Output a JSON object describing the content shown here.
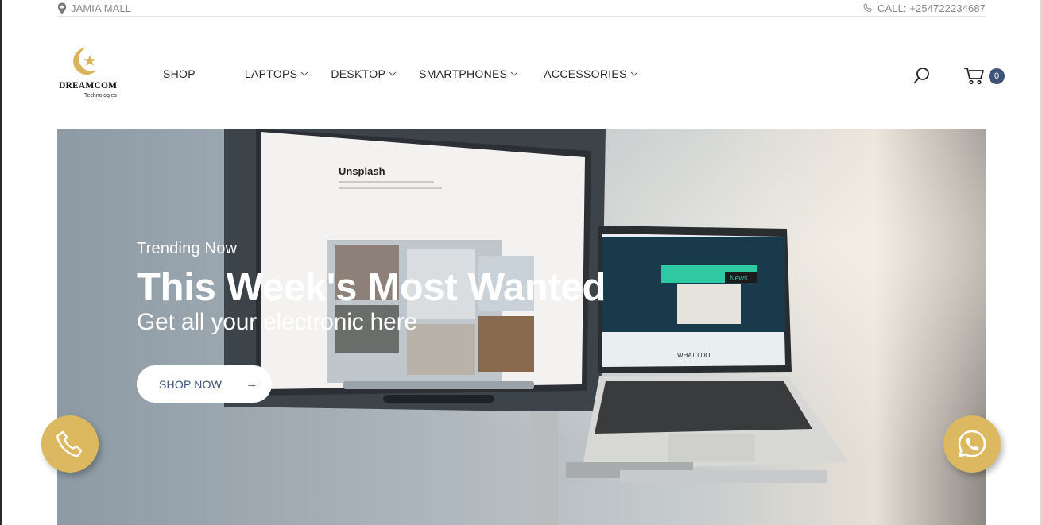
{
  "topbar": {
    "location": "JAMIA MALL",
    "phone": "CALL: +254722234687"
  },
  "logo": {
    "brand": "DREAMCOM",
    "tagline": "Technologies"
  },
  "nav": {
    "items": [
      {
        "label": "SHOP",
        "has_dropdown": false
      },
      {
        "label": "LAPTOPS",
        "has_dropdown": true
      },
      {
        "label": "DESKTOP",
        "has_dropdown": true
      },
      {
        "label": "SMARTPHONES",
        "has_dropdown": true
      },
      {
        "label": "ACCESSORIES",
        "has_dropdown": true
      }
    ]
  },
  "header": {
    "cart_count": "0"
  },
  "hero": {
    "eyebrow": "Trending Now",
    "headline": "This Week's Most Wanted",
    "subhead": "Get all your electronic here",
    "cta_label": "SHOP NOW",
    "cta_arrow": "→",
    "screen_title": "Unsplash",
    "laptop_badge": "News",
    "laptop_section": "WHAT I DO"
  },
  "floating": {
    "left_icon": "phone-icon",
    "right_icon": "whatsapp-icon"
  },
  "colors": {
    "accent_gold": "#dcb860",
    "brand_navy": "#3d5477",
    "text_dark": "#2b2b2b",
    "text_muted": "#8a8a8a"
  }
}
